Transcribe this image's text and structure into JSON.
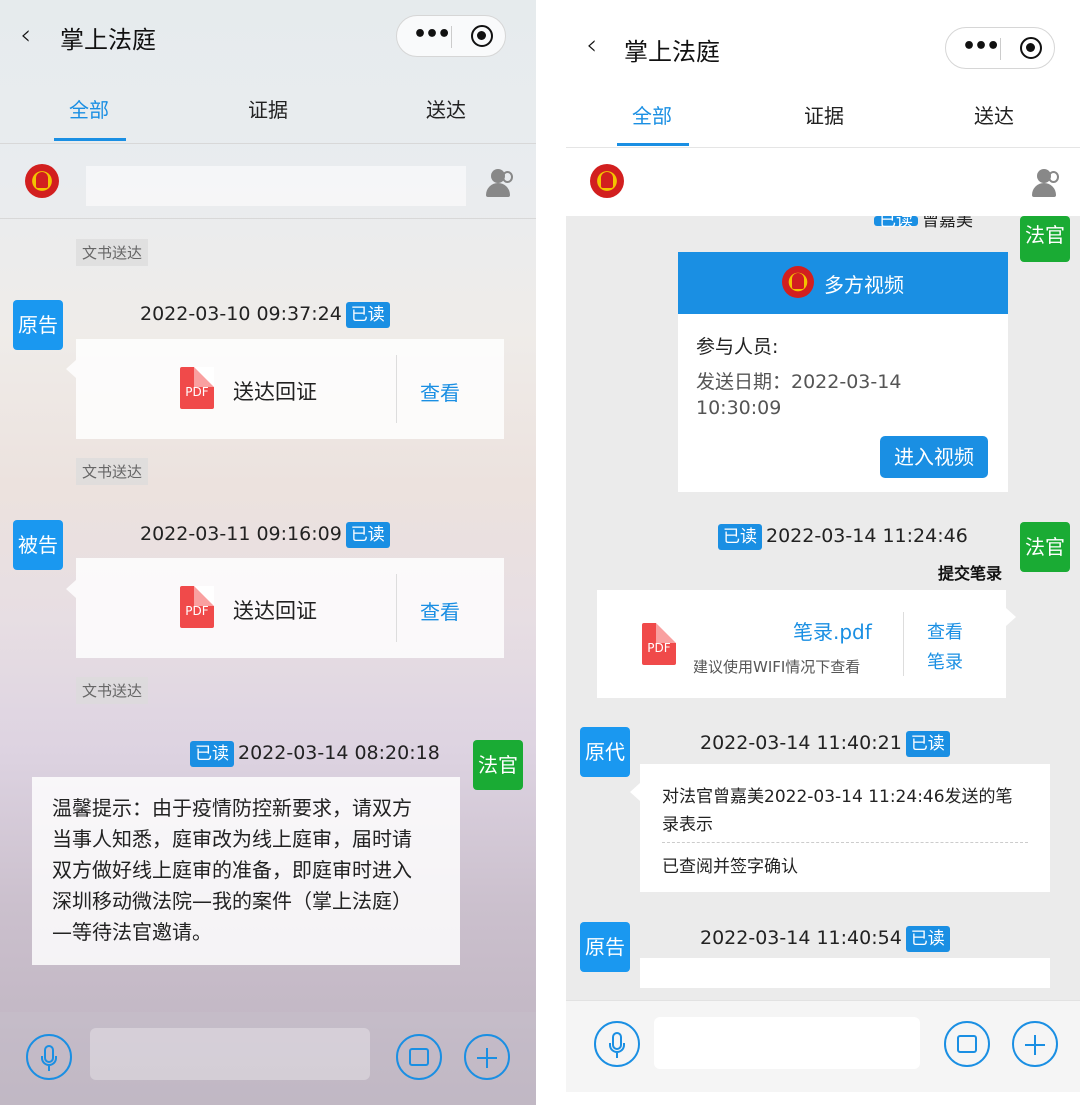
{
  "left": {
    "nav": {
      "title": "掌上法庭",
      "back_icon": "chevron-left-icon",
      "more_icon": "more-dots-icon",
      "close_icon": "target-close-icon"
    },
    "tabs": [
      {
        "label": "全部",
        "active": true
      },
      {
        "label": "证据",
        "active": false
      },
      {
        "label": "送达",
        "active": false
      }
    ],
    "header": {
      "emblem_icon": "court-emblem-icon",
      "members_icon": "members-icon"
    },
    "messages": [
      {
        "tag": "文书送达",
        "sender": "原告",
        "time": "2022-03-10 09:37:24",
        "read": "已读",
        "file": "送达回证",
        "action": "查看"
      },
      {
        "tag": "文书送达",
        "sender": "被告",
        "time": "2022-03-11 09:16:09",
        "read": "已读",
        "file": "送达回证",
        "action": "查看"
      },
      {
        "tag": "文书送达",
        "sender": "法官",
        "time": "2022-03-14 08:20:18",
        "read": "已读",
        "text_lines": [
          "温馨提示：由于疫情防控新要求，请双方",
          "当事人知悉，庭审改为线上庭审，届时请",
          "双方做好线上庭审的准备，即庭审时进入",
          "深圳移动微法院—我的案件（掌上法庭）",
          "—等待法官邀请。"
        ]
      }
    ],
    "pdf_label": "PDF",
    "bottom": {
      "voice_icon": "microphone-icon",
      "image_icon": "image-icon",
      "plus_icon": "plus-icon"
    }
  },
  "right": {
    "nav": {
      "title": "掌上法庭",
      "back_icon": "chevron-left-icon",
      "more_icon": "more-dots-icon",
      "close_icon": "target-close-icon"
    },
    "tabs": [
      {
        "label": "全部",
        "active": true
      },
      {
        "label": "证据",
        "active": false
      },
      {
        "label": "送达",
        "active": false
      }
    ],
    "header": {
      "emblem_icon": "court-emblem-icon",
      "members_icon": "members-icon"
    },
    "partial_top": {
      "read": "已读",
      "name": "曾嘉美",
      "sender": "法官"
    },
    "video_card": {
      "title": "多方视频",
      "participants": "参与人员:",
      "date_label": "发送日期：2022-03-14",
      "date_time": "10:30:09",
      "button": "进入视频"
    },
    "record_msg": {
      "read": "已读",
      "time": "2022-03-14 11:24:46",
      "sender": "法官",
      "caption": "提交笔录",
      "file": "笔录.pdf",
      "hint": "建议使用WIFI情况下查看",
      "action_line1": "查看",
      "action_line2": "笔录",
      "pdf_label": "PDF"
    },
    "sign_msg": {
      "sender": "原代",
      "time": "2022-03-14 11:40:21",
      "read": "已读",
      "line1": "对法官曾嘉美2022-03-14 11:24:46发送的笔",
      "line2": "录表示",
      "line3": "已查阅并签字确认"
    },
    "last_msg": {
      "sender": "原告",
      "time": "2022-03-14 11:40:54",
      "read": "已读"
    },
    "bottom": {
      "voice_icon": "microphone-icon",
      "image_icon": "image-icon",
      "plus_icon": "plus-icon"
    }
  },
  "colors": {
    "accent": "#1a8fe3",
    "judge_green": "#1aab34",
    "party_blue": "#1a98f0",
    "pdf_red": "#f04a4a"
  }
}
